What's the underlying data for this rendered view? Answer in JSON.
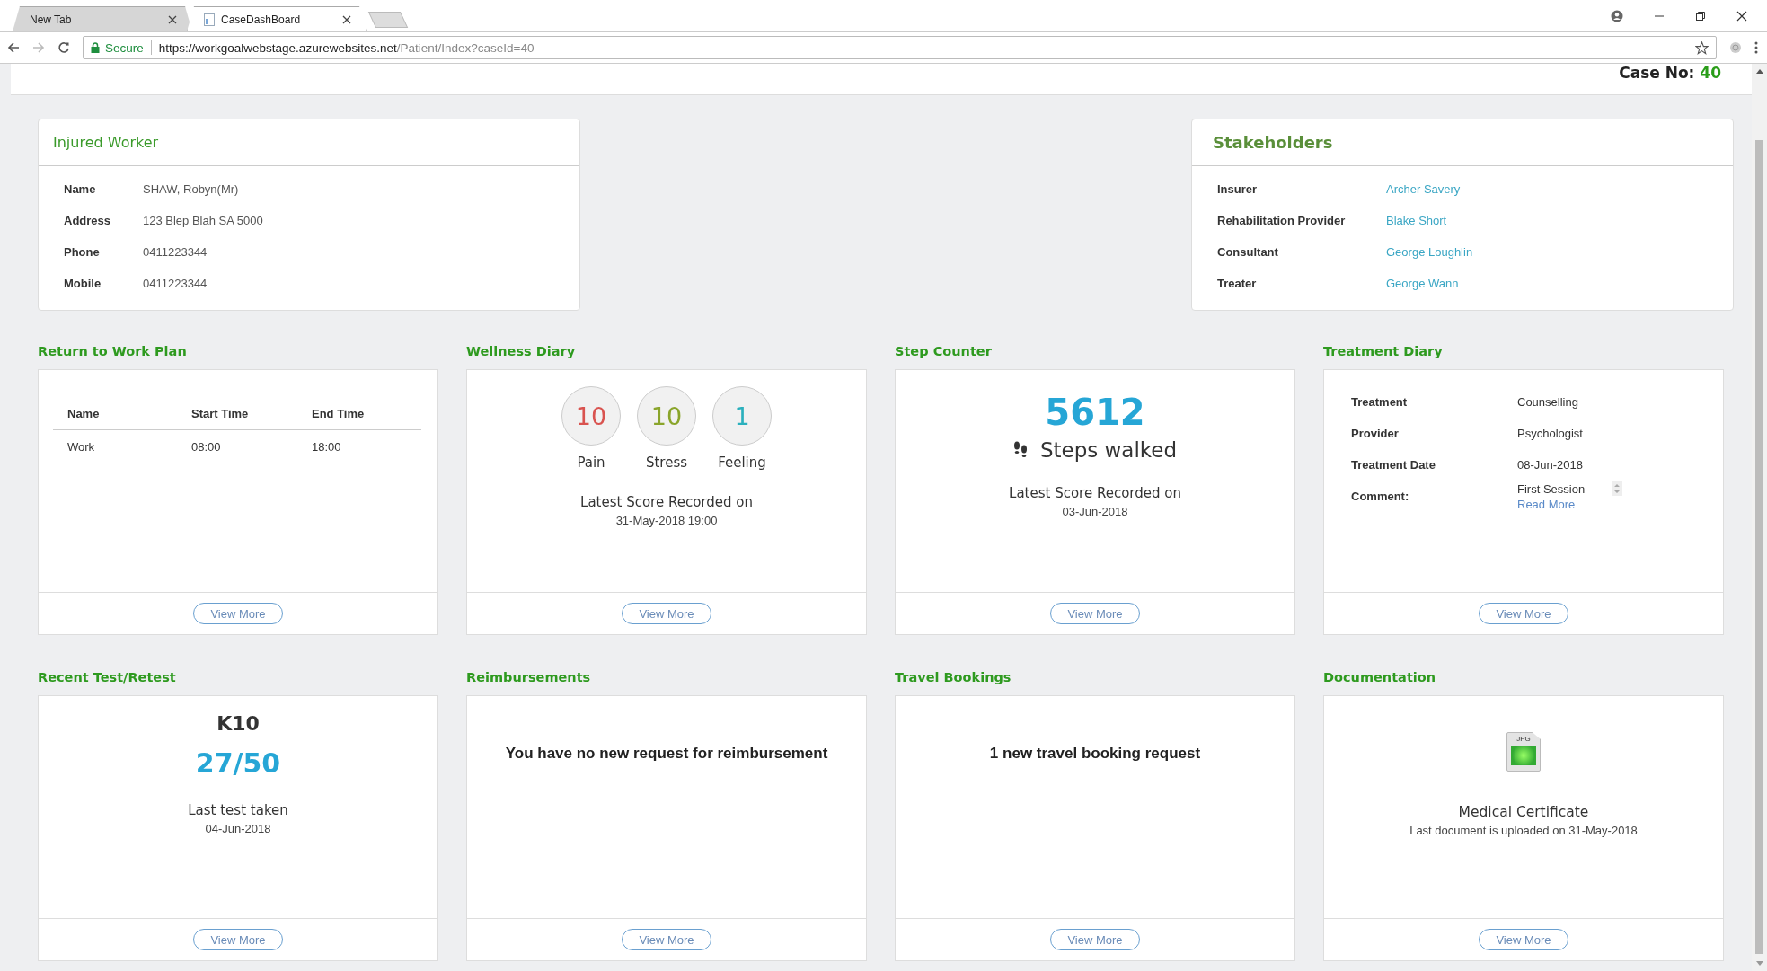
{
  "browser": {
    "tabs": [
      {
        "label": "New Tab",
        "selected": false
      },
      {
        "label": "CaseDashBoard",
        "selected": true
      }
    ],
    "security": "Secure",
    "url_host": "https://workgoalwebstage.azurewebsites.net",
    "url_path": "/Patient/Index?caseId=40"
  },
  "header": {
    "case_label": "Case No:",
    "case_number": "40"
  },
  "injured_worker": {
    "title": "Injured Worker",
    "rows": [
      {
        "label": "Name",
        "value": "SHAW, Robyn(Mr)"
      },
      {
        "label": "Address",
        "value": "123 Blep Blah SA 5000"
      },
      {
        "label": "Phone",
        "value": "0411223344"
      },
      {
        "label": "Mobile",
        "value": "0411223344"
      }
    ]
  },
  "stakeholders": {
    "title": "Stakeholders",
    "rows": [
      {
        "label": "Insurer",
        "value": "Archer Savery"
      },
      {
        "label": "Rehabilitation Provider",
        "value": "Blake Short"
      },
      {
        "label": "Consultant",
        "value": "George Loughlin"
      },
      {
        "label": "Treater",
        "value": "George Wann"
      }
    ]
  },
  "widgets": [
    {
      "kind": "plan",
      "title": "Return to Work Plan",
      "columns": [
        "Name",
        "Start Time",
        "End Time"
      ],
      "rows": [
        [
          "Work",
          "08:00",
          "18:00"
        ]
      ],
      "button": "View More"
    },
    {
      "kind": "wellness",
      "title": "Wellness Diary",
      "scores": [
        {
          "value": "10",
          "label": "Pain",
          "color": "#d9534f"
        },
        {
          "value": "10",
          "label": "Stress",
          "color": "#8aa52b"
        },
        {
          "value": "1",
          "label": "Feeling",
          "color": "#2bb0bd"
        }
      ],
      "caption": "Latest Score Recorded on",
      "date": "31-May-2018 19:00",
      "button": "View More"
    },
    {
      "kind": "steps",
      "title": "Step Counter",
      "count": "5612",
      "unit": "Steps walked",
      "caption": "Latest Score Recorded on",
      "date": "03-Jun-2018",
      "button": "View More"
    },
    {
      "kind": "treatment",
      "title": "Treatment Diary",
      "rows": [
        {
          "label": "Treatment",
          "value": "Counselling"
        },
        {
          "label": "Provider",
          "value": "Psychologist"
        },
        {
          "label": "Treatment Date",
          "value": "08-Jun-2018"
        }
      ],
      "comment_label": "Comment:",
      "comment": "First Session",
      "link": "Read More",
      "button": "View More"
    },
    {
      "kind": "test",
      "title": "Recent Test/Retest",
      "test": "K10",
      "score": "27/50",
      "caption": "Last test taken",
      "date": "04-Jun-2018",
      "button": "View More"
    },
    {
      "kind": "message",
      "title": "Reimbursements",
      "message": "You have no new request for reimbursement",
      "button": "View More"
    },
    {
      "kind": "message",
      "title": "Travel Bookings",
      "message": "1 new travel booking request",
      "button": "View More"
    },
    {
      "kind": "document",
      "title": "Documentation",
      "file_type": "JPG",
      "name": "Medical Certificate",
      "caption": "Last document is uploaded on 31-May-2018",
      "button": "View More"
    }
  ]
}
